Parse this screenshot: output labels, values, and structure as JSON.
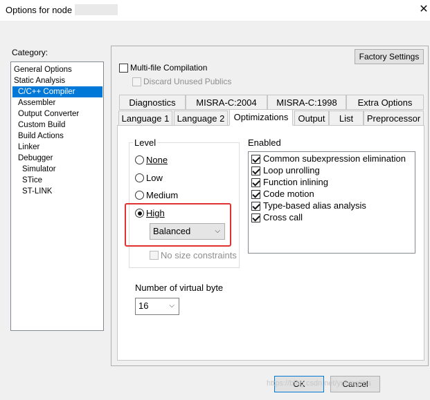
{
  "window": {
    "title": "Options for node",
    "close_glyph": "✕"
  },
  "category": {
    "label": "Category:",
    "items": [
      "General Options",
      "Static Analysis",
      "C/C++ Compiler",
      "Assembler",
      "Output Converter",
      "Custom Build",
      "Build Actions",
      "Linker",
      "Debugger",
      "Simulator",
      "STice",
      "ST-LINK"
    ],
    "selected_index": 2
  },
  "factory_button": "Factory Settings",
  "multifile": {
    "label": "Multi-file Compilation",
    "checked": false
  },
  "discard": {
    "label": "Discard Unused Publics",
    "checked": false,
    "disabled": true
  },
  "tabs_row1": [
    "Diagnostics",
    "MISRA-C:2004",
    "MISRA-C:1998",
    "Extra Options"
  ],
  "tabs_row2": [
    "Language 1",
    "Language 2",
    "Optimizations",
    "Output",
    "List",
    "Preprocessor"
  ],
  "active_tab": "Optimizations",
  "level": {
    "title": "Level",
    "options": [
      "None",
      "Low",
      "Medium",
      "High"
    ],
    "selected": "High",
    "high_mode": "Balanced",
    "no_size_label": "No size constraints"
  },
  "enabled": {
    "title": "Enabled",
    "items": [
      {
        "label": "Common subexpression elimination",
        "checked": true
      },
      {
        "label": "Loop unrolling",
        "checked": true
      },
      {
        "label": "Function inlining",
        "checked": true
      },
      {
        "label": "Code motion",
        "checked": true
      },
      {
        "label": "Type-based alias analysis",
        "checked": true
      },
      {
        "label": "Cross call",
        "checked": true
      }
    ]
  },
  "virtual_byte": {
    "label": "Number of virtual byte",
    "value": "16"
  },
  "buttons": {
    "ok": "OK",
    "cancel": "Cancel"
  },
  "watermark": "https://blog.csdn.net/yuningliba",
  "colors": {
    "selection": "#0078d7",
    "highlight_box": "#e0302f"
  }
}
